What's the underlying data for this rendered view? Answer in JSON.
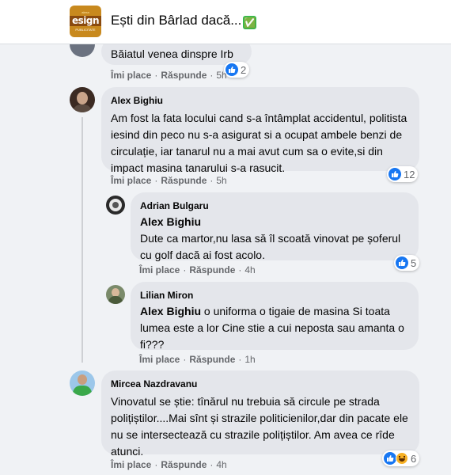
{
  "header": {
    "group_title": "Ești din Bârlad dacă...",
    "title_emoji": "✅",
    "logo_text": "esign",
    "logo_small": "PUBLICITATE",
    "logo_tiny": "alexa"
  },
  "actions_labels": {
    "like": "Îmi place",
    "reply": "Răspunde"
  },
  "comments": [
    {
      "author": "",
      "text": "Băiatul venea dinspre Irb",
      "time": "5h",
      "reactions": "2"
    },
    {
      "author": "Alex Bighiu",
      "text": "Am fost la fata locului cand s-a întâmplat accidentul, politista iesind din peco nu s-a asigurat si a ocupat ambele benzi de circulație, iar tanarul nu a mai avut cum sa o evite,si din impact masina tanarului s-a rasucit.",
      "time": "5h",
      "reactions": "12"
    },
    {
      "author": "Adrian Bulgaru",
      "mention": "Alex Bighiu",
      "text": "Dute ca martor,nu lasa să îl scoată vinovat pe șoferul cu golf dacă ai fost acolo.",
      "time": "4h",
      "reactions": "5"
    },
    {
      "author": "Lilian Miron",
      "mention": "Alex Bighiu",
      "text": "o uniforma o tigaie de masina Si toata lumea este a lor Cine stie a cui neposta sau amanta o fi???",
      "time": "1h"
    },
    {
      "author": "Mircea Nazdravanu",
      "text": "Vinovatul se știe: tînărul nu trebuia să circule pe strada polițiștilor....Mai sînt și strazile politicienilor,dar din pacate ele nu se intersectează cu strazile polițiștilor. Am avea ce rîde atunci.",
      "time": "4h",
      "reactions": "6"
    }
  ]
}
